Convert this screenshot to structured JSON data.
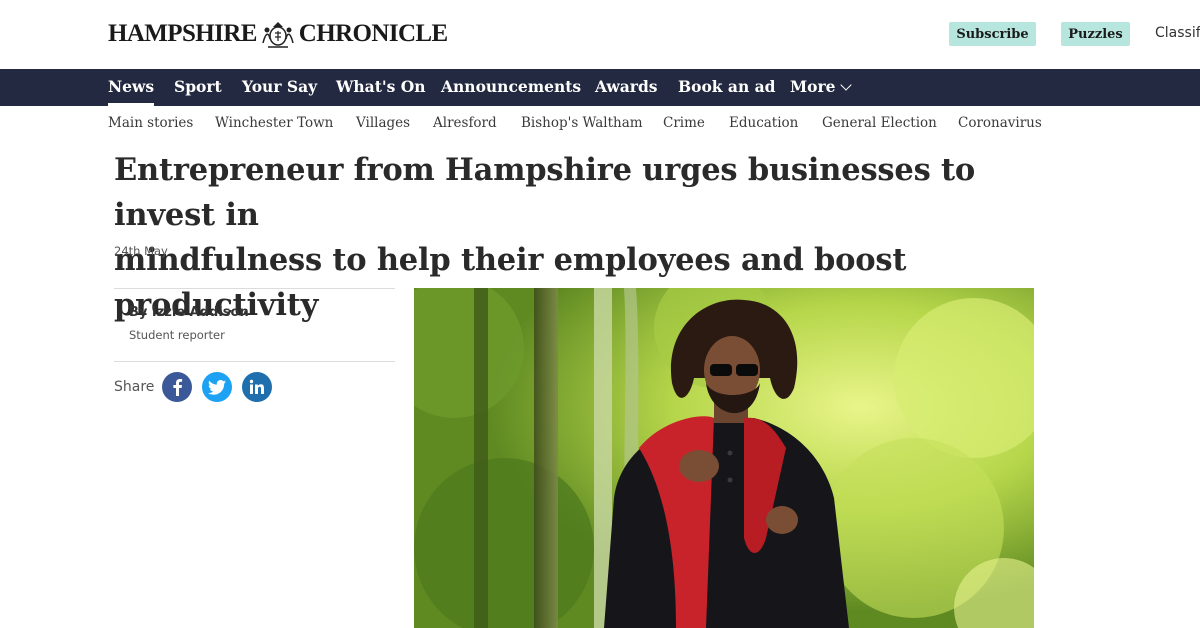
{
  "header": {
    "logo_text_left": "HAMPSHIRE",
    "logo_text_right": "CHRONICLE",
    "subscribe_label": "Subscribe",
    "puzzles_label": "Puzzles",
    "classified_label": "Classif"
  },
  "nav": {
    "items": [
      "News",
      "Sport",
      "Your Say",
      "What's On",
      "Announcements",
      "Awards",
      "Book an ad",
      "More"
    ],
    "active": "News"
  },
  "subnav": {
    "items": [
      "Main stories",
      "Winchester Town",
      "Villages",
      "Alresford",
      "Bishop's Waltham",
      "Crime",
      "Education",
      "General Election",
      "Coronavirus"
    ]
  },
  "article": {
    "headline_line1": "Entrepreneur from Hampshire urges businesses to invest in",
    "headline_line2": "mindfulness to help their employees and boost productivity",
    "date": "24th May",
    "byline": "By Izzie Addison",
    "role": "Student reporter",
    "share_label": "Share"
  },
  "icons": {
    "facebook": "facebook-icon",
    "twitter": "twitter-icon",
    "linkedin": "linkedin-icon",
    "more_chevron": "chevron-down-icon"
  },
  "colors": {
    "nav_bg": "#232940",
    "pill_bg": "#b7e6de",
    "facebook": "#3b5998",
    "twitter": "#1da1f2",
    "linkedin": "#1f6fae"
  }
}
